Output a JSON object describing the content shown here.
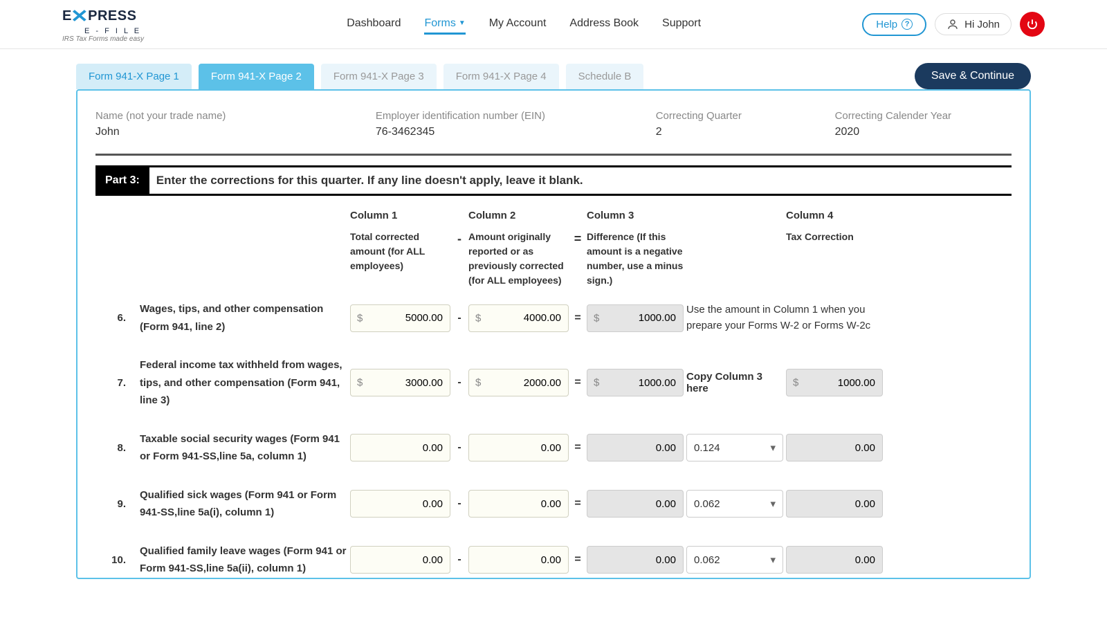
{
  "brand": {
    "name_top": "PRESS",
    "name_efile": "E - F I L E",
    "tagline": "IRS Tax Forms made easy"
  },
  "nav": {
    "dashboard": "Dashboard",
    "forms": "Forms",
    "my_account": "My Account",
    "address_book": "Address Book",
    "support": "Support"
  },
  "header_right": {
    "help": "Help",
    "greeting": "Hi John"
  },
  "tabs": {
    "p1": "Form 941-X Page 1",
    "p2": "Form 941-X Page 2",
    "p3": "Form 941-X Page 3",
    "p4": "Form 941-X Page 4",
    "sb": "Schedule B"
  },
  "save_btn": "Save & Continue",
  "info": {
    "name_label": "Name (not your trade name)",
    "name_value": "John",
    "ein_label": "Employer identification number (EIN)",
    "ein_value": "76-3462345",
    "quarter_label": "Correcting Quarter",
    "quarter_value": "2",
    "year_label": "Correcting Calender Year",
    "year_value": "2020"
  },
  "part": {
    "chip": "Part 3:",
    "title": "Enter the corrections for this quarter. If any line doesn't apply, leave it blank."
  },
  "columns": {
    "h1": "Column 1",
    "s1": "Total corrected amount (for ALL employees)",
    "h2": "Column 2",
    "s2": "Amount originally reported or as previously corrected (for ALL employees)",
    "h3": "Column 3",
    "s3": "Difference (If this amount is a negative number, use a minus sign.)",
    "h4": "Column 4",
    "s4": "Tax Correction",
    "minus": "-",
    "equals": "="
  },
  "rows": {
    "r6": {
      "num": "6.",
      "label": "Wages, tips, and other compensation (Form 941, line 2)",
      "c1": "5000.00",
      "c2": "4000.00",
      "c3": "1000.00",
      "note": "Use the amount in Column 1 when you prepare your Forms W-2 or Forms W-2c"
    },
    "r7": {
      "num": "7.",
      "label": "Federal income tax withheld from wages, tips, and other compensation (Form 941, line 3)",
      "c1": "3000.00",
      "c2": "2000.00",
      "c3": "1000.00",
      "note_label": "Copy Column 3 here",
      "c4": "1000.00"
    },
    "r8": {
      "num": "8.",
      "label": "Taxable social security wages (Form 941 or Form 941-SS,line 5a, column 1)",
      "c1": "0.00",
      "c2": "0.00",
      "c3": "0.00",
      "rate": "0.124",
      "c4": "0.00"
    },
    "r9": {
      "num": "9.",
      "label": "Qualified sick wages (Form 941 or Form 941-SS,line 5a(i), column 1)",
      "c1": "0.00",
      "c2": "0.00",
      "c3": "0.00",
      "rate": "0.062",
      "c4": "0.00"
    },
    "r10": {
      "num": "10.",
      "label": "Qualified family leave wages (Form 941 or Form 941-SS,line 5a(ii), column 1)",
      "c1": "0.00",
      "c2": "0.00",
      "c3": "0.00",
      "rate": "0.062",
      "c4": "0.00"
    }
  }
}
